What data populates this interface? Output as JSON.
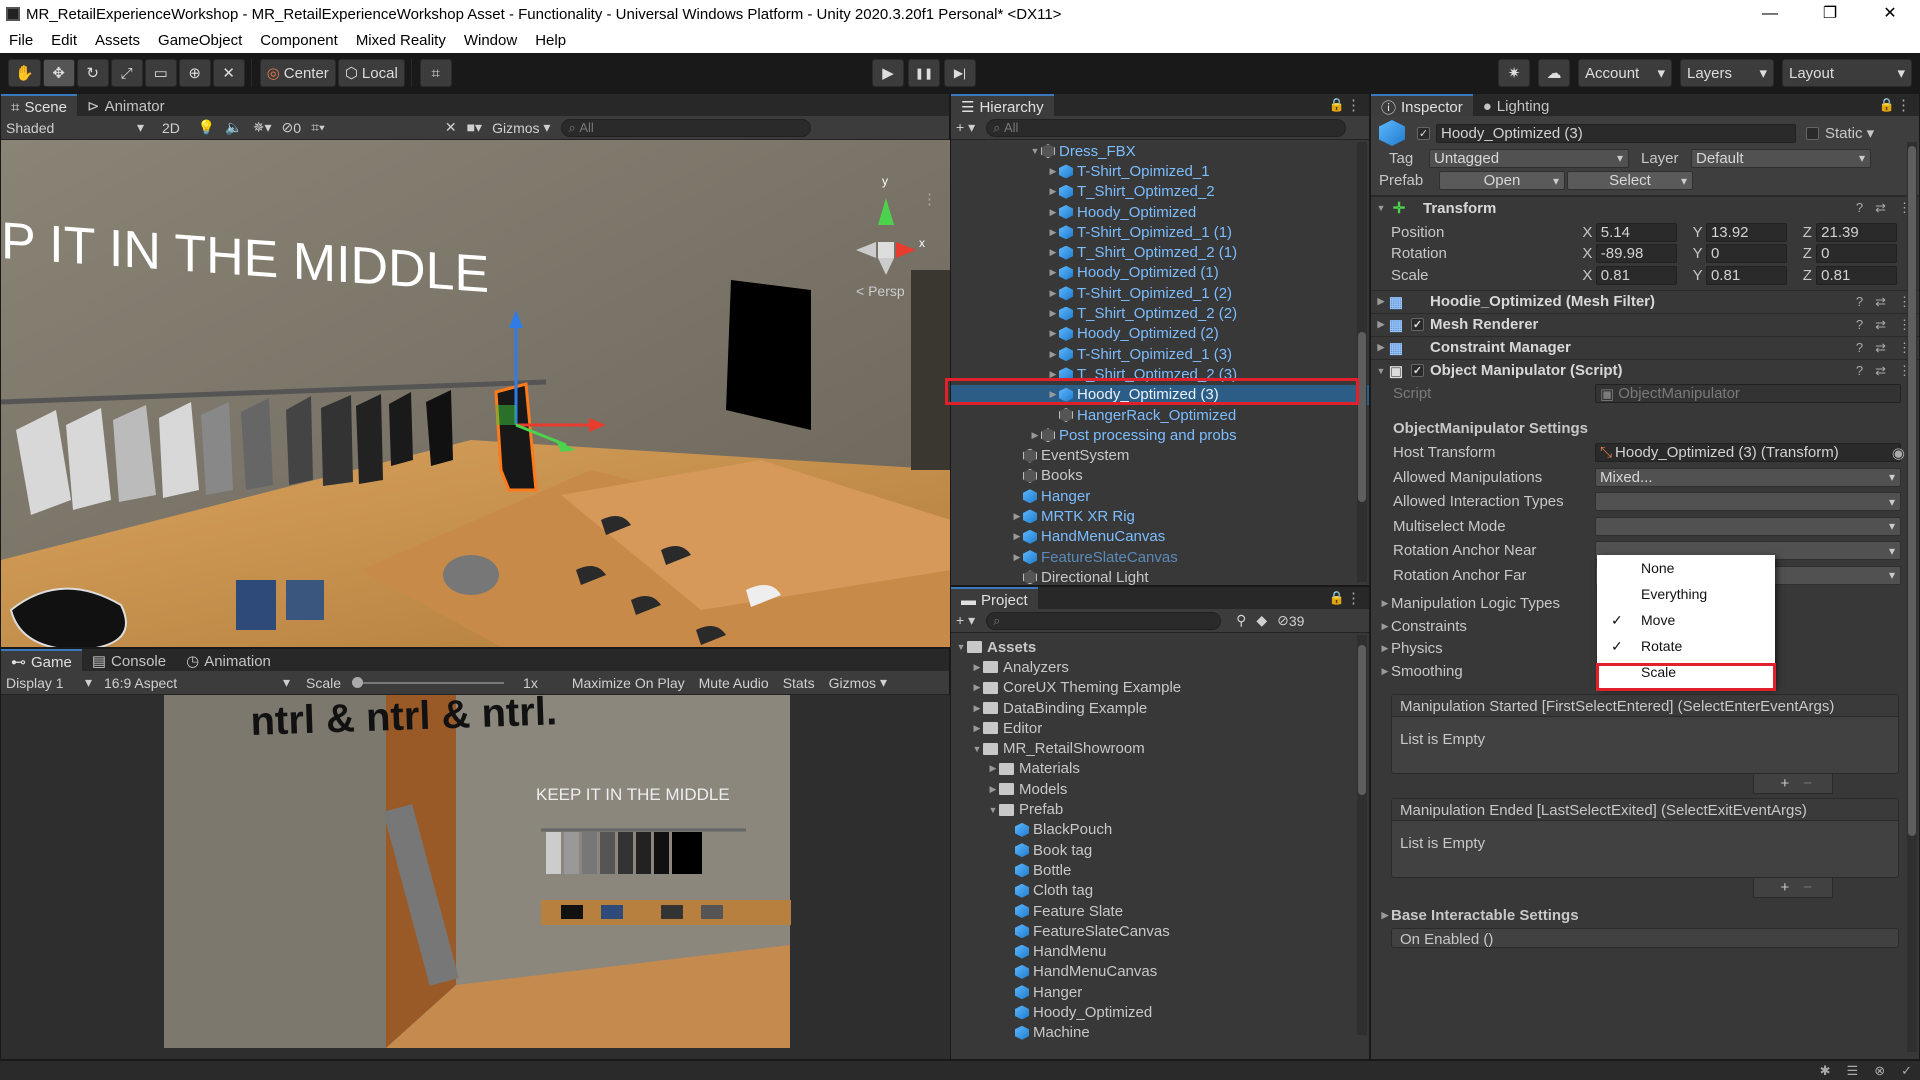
{
  "window": {
    "title": "MR_RetailExperienceWorkshop - MR_RetailExperienceWorkshop Asset - Functionality - Universal Windows Platform - Unity 2020.3.20f1 Personal* <DX11>",
    "minimize": "—",
    "restore": "❐",
    "close": "✕"
  },
  "menu": [
    "File",
    "Edit",
    "Assets",
    "GameObject",
    "Component",
    "Mixed Reality",
    "Window",
    "Help"
  ],
  "toolbar": {
    "center_label": "Center",
    "local_label": "Local",
    "account_label": "Account",
    "layers_label": "Layers",
    "layout_label": "Layout",
    "play": "▶",
    "pause": "❚❚",
    "step": "▶|"
  },
  "scene": {
    "tabs": [
      "Scene",
      "Animator"
    ],
    "shading": "Shaded",
    "mode_2d": "2D",
    "hidden_count": "0",
    "gizmos": "Gizmos",
    "search_placeholder": "All",
    "wall_text": "P IT IN THE MIDDLE",
    "persp": "< Persp",
    "axis_y": "y",
    "axis_x": "x"
  },
  "game": {
    "tabs": [
      "Game",
      "Console",
      "Animation"
    ],
    "display": "Display 1",
    "aspect": "16:9 Aspect",
    "scale_label": "Scale",
    "scale_value": "1x",
    "maximize": "Maximize On Play",
    "mute": "Mute Audio",
    "stats": "Stats",
    "gizmos": "Gizmos",
    "wall_text": "KEEP IT IN THE MIDDLE",
    "ntrl_text": "ntrl & ntrl & ntrl."
  },
  "hierarchy": {
    "tab": "Hierarchy",
    "search_placeholder": "All",
    "items": [
      {
        "label": "Dress_FBX",
        "indent": 4,
        "tri": "▼",
        "icon": "gray",
        "color": "blue",
        "chev": false
      },
      {
        "label": "T-Shirt_Opimized_1",
        "indent": 5,
        "tri": "▶",
        "icon": "blue",
        "color": "blue",
        "chev": true
      },
      {
        "label": "T_Shirt_Optimzed_2",
        "indent": 5,
        "tri": "▶",
        "icon": "blue",
        "color": "blue",
        "chev": true
      },
      {
        "label": "Hoody_Optimized",
        "indent": 5,
        "tri": "▶",
        "icon": "blue",
        "color": "blue",
        "chev": true
      },
      {
        "label": "T-Shirt_Opimized_1 (1)",
        "indent": 5,
        "tri": "▶",
        "icon": "blue",
        "color": "blue",
        "chev": true
      },
      {
        "label": "T_Shirt_Optimzed_2 (1)",
        "indent": 5,
        "tri": "▶",
        "icon": "blue",
        "color": "blue",
        "chev": true
      },
      {
        "label": "Hoody_Optimized (1)",
        "indent": 5,
        "tri": "▶",
        "icon": "blue",
        "color": "blue",
        "chev": true
      },
      {
        "label": "T-Shirt_Opimized_1 (2)",
        "indent": 5,
        "tri": "▶",
        "icon": "blue",
        "color": "blue",
        "chev": true
      },
      {
        "label": "T_Shirt_Optimzed_2 (2)",
        "indent": 5,
        "tri": "▶",
        "icon": "blue",
        "color": "blue",
        "chev": true
      },
      {
        "label": "Hoody_Optimized (2)",
        "indent": 5,
        "tri": "▶",
        "icon": "blue",
        "color": "blue",
        "chev": true
      },
      {
        "label": "T-Shirt_Opimized_1 (3)",
        "indent": 5,
        "tri": "▶",
        "icon": "blue",
        "color": "blue",
        "chev": true
      },
      {
        "label": "T_Shirt_Optimzed_2 (3)",
        "indent": 5,
        "tri": "▶",
        "icon": "blue",
        "color": "blue",
        "chev": true
      },
      {
        "label": "Hoody_Optimized (3)",
        "indent": 5,
        "tri": "▶",
        "icon": "blue",
        "color": "light",
        "chev": true,
        "selected": true
      },
      {
        "label": "HangerRack_Optimized",
        "indent": 5,
        "tri": "",
        "icon": "gray",
        "color": "blue",
        "chev": false
      },
      {
        "label": "Post processing and probs",
        "indent": 4,
        "tri": "▶",
        "icon": "gray",
        "color": "blue",
        "chev": false
      },
      {
        "label": "EventSystem",
        "indent": 3,
        "tri": "",
        "icon": "gray",
        "color": "white",
        "chev": false
      },
      {
        "label": "Books",
        "indent": 3,
        "tri": "",
        "icon": "gray",
        "color": "white",
        "chev": false
      },
      {
        "label": "Hanger",
        "indent": 3,
        "tri": "",
        "icon": "blue",
        "color": "blue",
        "chev": true
      },
      {
        "label": "MRTK XR Rig",
        "indent": 3,
        "tri": "▶",
        "icon": "blue",
        "color": "blue",
        "chev": true
      },
      {
        "label": "HandMenuCanvas",
        "indent": 3,
        "tri": "▶",
        "icon": "blue",
        "color": "blue",
        "chev": true
      },
      {
        "label": "FeatureSlateCanvas",
        "indent": 3,
        "tri": "▶",
        "icon": "blue",
        "color": "dim",
        "chev": true
      },
      {
        "label": "Directional Light",
        "indent": 3,
        "tri": "",
        "icon": "gray",
        "color": "white",
        "chev": false
      }
    ]
  },
  "project": {
    "tab": "Project",
    "hidden_count": "39",
    "items": [
      {
        "label": "Assets",
        "indent": 0,
        "tri": "▼",
        "type": "folder",
        "bold": true
      },
      {
        "label": "Analyzers",
        "indent": 1,
        "tri": "▶",
        "type": "folder"
      },
      {
        "label": "CoreUX Theming Example",
        "indent": 1,
        "tri": "▶",
        "type": "folder"
      },
      {
        "label": "DataBinding Example",
        "indent": 1,
        "tri": "▶",
        "type": "folder"
      },
      {
        "label": "Editor",
        "indent": 1,
        "tri": "▶",
        "type": "folder"
      },
      {
        "label": "MR_RetailShowroom",
        "indent": 1,
        "tri": "▼",
        "type": "folder"
      },
      {
        "label": "Materials",
        "indent": 2,
        "tri": "▶",
        "type": "folder"
      },
      {
        "label": "Models",
        "indent": 2,
        "tri": "▶",
        "type": "folder"
      },
      {
        "label": "Prefab",
        "indent": 2,
        "tri": "▼",
        "type": "folder"
      },
      {
        "label": "BlackPouch",
        "indent": 3,
        "tri": "",
        "type": "prefab"
      },
      {
        "label": "Book tag",
        "indent": 3,
        "tri": "",
        "type": "prefab"
      },
      {
        "label": "Bottle",
        "indent": 3,
        "tri": "",
        "type": "prefab"
      },
      {
        "label": "Cloth tag",
        "indent": 3,
        "tri": "",
        "type": "prefab"
      },
      {
        "label": "Feature Slate",
        "indent": 3,
        "tri": "",
        "type": "prefab"
      },
      {
        "label": "FeatureSlateCanvas",
        "indent": 3,
        "tri": "",
        "type": "prefab"
      },
      {
        "label": "HandMenu",
        "indent": 3,
        "tri": "",
        "type": "prefab"
      },
      {
        "label": "HandMenuCanvas",
        "indent": 3,
        "tri": "",
        "type": "prefab"
      },
      {
        "label": "Hanger",
        "indent": 3,
        "tri": "",
        "type": "prefab"
      },
      {
        "label": "Hoody_Optimized",
        "indent": 3,
        "tri": "",
        "type": "prefab"
      },
      {
        "label": "Machine",
        "indent": 3,
        "tri": "",
        "type": "prefab"
      }
    ]
  },
  "inspector": {
    "tabs": [
      "Inspector",
      "Lighting"
    ],
    "object_name": "Hoody_Optimized (3)",
    "static_label": "Static",
    "tag_label": "Tag",
    "tag_value": "Untagged",
    "layer_label": "Layer",
    "layer_value": "Default",
    "prefab_label": "Prefab",
    "open_label": "Open",
    "select_label": "Select",
    "transform": {
      "title": "Transform",
      "position_label": "Position",
      "rotation_label": "Rotation",
      "scale_label": "Scale",
      "px": "5.14",
      "py": "13.92",
      "pz": "21.39",
      "rx": "-89.98",
      "ry": "0",
      "rz": "0",
      "sx": "0.81",
      "sy": "0.81",
      "sz": "0.81",
      "x": "X",
      "y": "Y",
      "z": "Z"
    },
    "components": [
      {
        "title": "Hoodie_Optimized (Mesh Filter)",
        "check": false
      },
      {
        "title": "Mesh Renderer",
        "check": true
      },
      {
        "title": "Constraint Manager",
        "check": false
      }
    ],
    "om": {
      "title": "Object Manipulator (Script)",
      "script_label": "Script",
      "script_value": "ObjectManipulator",
      "settings_label": "ObjectManipulator Settings",
      "host_label": "Host Transform",
      "host_value": "Hoody_Optimized (3) (Transform)",
      "allowed_label": "Allowed Manipulations",
      "allowed_value": "Mixed...",
      "interaction_label": "Allowed Interaction Types",
      "multiselect_label": "Multiselect Mode",
      "anchor_near_label": "Rotation Anchor Near",
      "anchor_far_label": "Rotation Anchor Far",
      "logic_label": "Manipulation Logic Types",
      "constraints_label": "Constraints",
      "physics_label": "Physics",
      "smoothing_label": "Smoothing",
      "started_label": "Manipulation Started [FirstSelectEntered] (SelectEnterEventArgs)",
      "ended_label": "Manipulation Ended [LastSelectExited] (SelectExitEventArgs)",
      "empty_label": "List is Empty",
      "base_label": "Base Interactable Settings",
      "on_enabled_label": "On Enabled ()"
    },
    "popup": [
      {
        "label": "None",
        "checked": false
      },
      {
        "label": "Everything",
        "checked": false
      },
      {
        "label": "Move",
        "checked": true
      },
      {
        "label": "Rotate",
        "checked": true
      },
      {
        "label": "Scale",
        "checked": false,
        "highlight": true
      }
    ],
    "checkmark": "✓"
  },
  "colors": {
    "accent": "#3a79bb",
    "highlight": "#e0202a",
    "link_blue": "#7cbdff"
  }
}
